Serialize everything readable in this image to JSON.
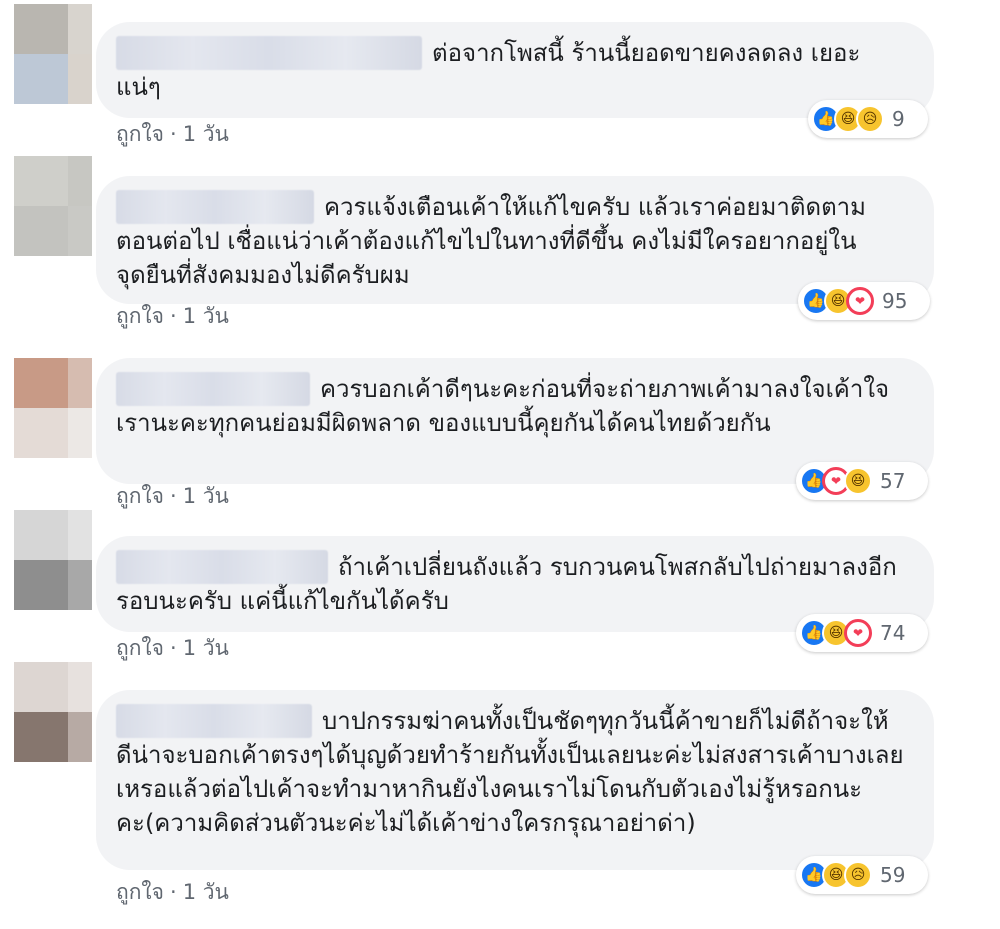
{
  "comments": [
    {
      "text": "ต่อจากโพสนี้ ร้านนี้ยอดขายคงลดลง เยอะแน่ๆ",
      "reactions": {
        "icons": [
          "like-icon",
          "haha-icon",
          "sad-icon"
        ],
        "count": "9"
      },
      "meta": {
        "like_label": "ถูกใจ",
        "separator": "·",
        "time": "1 วัน"
      }
    },
    {
      "text": "ควรแจ้งเตือนเค้าให้แก้ไขครับ แล้วเราค่อยมาติดตามตอนต่อไป เชื่อแน่ว่าเค้าต้องแก้ไขไปในทางที่ดีขึ้น คงไม่มีใครอยากอยู่ในจุดยืนที่สังคมมองไม่ดีครับผม",
      "reactions": {
        "icons": [
          "like-icon",
          "haha-icon",
          "love-icon"
        ],
        "count": "95"
      },
      "meta": {
        "like_label": "ถูกใจ",
        "separator": "·",
        "time": "1 วัน"
      }
    },
    {
      "text": "ควรบอกเค้าดีๆนะคะก่อนที่จะถ่ายภาพเค้ามาลงใจเค้าใจเรานะคะทุกคนย่อมมีผิดพลาด ของแบบนี้คุยกันได้คนไทยด้วยกัน",
      "reactions": {
        "icons": [
          "like-icon",
          "love-icon",
          "haha-icon"
        ],
        "count": "57"
      },
      "meta": {
        "like_label": "ถูกใจ",
        "separator": "·",
        "time": "1 วัน"
      }
    },
    {
      "text": "ถ้าเค้าเปลี่ยนถังแล้ว รบกวนคนโพสกลับไปถ่ายมาลงอีกรอบนะครับ แค่นี้แก้ไขกันได้ครับ",
      "reactions": {
        "icons": [
          "like-icon",
          "haha-icon",
          "love-icon"
        ],
        "count": "74"
      },
      "meta": {
        "like_label": "ถูกใจ",
        "separator": "·",
        "time": "1 วัน"
      }
    },
    {
      "text": "บาปกรรมฆ่าคนทั้งเป็นชัดๆทุกวันนี้ค้าขายก็ไม่ดีถ้าจะให้ดีน่าจะบอกเค้าตรงๆได้บุญด้วยทำร้ายกันทั้งเป็นเลยนะค่ะไม่สงสารเค้าบางเลยเหรอแล้วต่อไปเค้าจะทำมาหากินยังไงคนเราไม่โดนกับตัวเองไม่รู้หรอกนะคะ(ความคิดส่วนตัวนะค่ะไม่ได้เค้าข่างใครกรุณาอย่าด่า)",
      "reactions": {
        "icons": [
          "like-icon",
          "haha-icon",
          "sad-icon"
        ],
        "count": "59"
      },
      "meta": {
        "like_label": "ถูกใจ",
        "separator": "·",
        "time": "1 วัน"
      }
    }
  ],
  "colors": {
    "bubble": "#f2f3f5",
    "meta_text": "#606770",
    "like_blue": "#1877f2",
    "love_red": "#f33e58",
    "emoji_yellow": "#f7c42e"
  }
}
